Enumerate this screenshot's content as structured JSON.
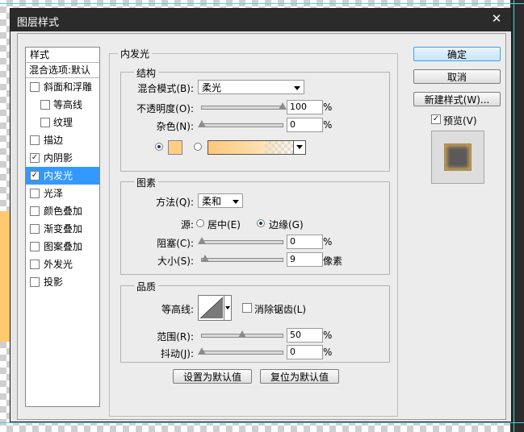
{
  "window": {
    "title": "图层样式",
    "close_glyph": "✕"
  },
  "style_list": {
    "header": "样式",
    "blend_options": "混合选项:默认",
    "items": [
      {
        "label": "斜面和浮雕",
        "checked": false,
        "indent": false
      },
      {
        "label": "等高线",
        "checked": false,
        "indent": true
      },
      {
        "label": "纹理",
        "checked": false,
        "indent": true
      },
      {
        "label": "描边",
        "checked": false,
        "indent": false
      },
      {
        "label": "内阴影",
        "checked": true,
        "indent": false
      },
      {
        "label": "内发光",
        "checked": true,
        "indent": false,
        "selected": true
      },
      {
        "label": "光泽",
        "checked": false,
        "indent": false
      },
      {
        "label": "颜色叠加",
        "checked": false,
        "indent": false
      },
      {
        "label": "渐变叠加",
        "checked": false,
        "indent": false
      },
      {
        "label": "图案叠加",
        "checked": false,
        "indent": false
      },
      {
        "label": "外发光",
        "checked": false,
        "indent": false
      },
      {
        "label": "投影",
        "checked": false,
        "indent": false
      }
    ]
  },
  "panel": {
    "title": "内发光",
    "structure": {
      "legend": "结构",
      "blend_mode_label": "混合模式(B):",
      "blend_mode_value": "柔光",
      "opacity_label": "不透明度(O):",
      "opacity_value": "100",
      "opacity_fraction": 1.0,
      "noise_label": "杂色(N):",
      "noise_value": "0",
      "noise_fraction": 0.0,
      "percent": "%",
      "glow_color": "#ffcd86"
    },
    "elements": {
      "legend": "图素",
      "technique_label": "方法(Q):",
      "technique_value": "柔和",
      "source_label": "源:",
      "source_center": "居中(E)",
      "source_edge": "边缘(G)",
      "choke_label": "阻塞(C):",
      "choke_value": "0",
      "choke_fraction": 0.0,
      "size_label": "大小(S):",
      "size_value": "9",
      "size_fraction": 0.036,
      "size_unit": "像素",
      "percent": "%"
    },
    "quality": {
      "legend": "品质",
      "contour_label": "等高线:",
      "antialias_label": "消除锯齿(L)",
      "range_label": "范围(R):",
      "range_value": "50",
      "range_fraction": 0.5,
      "jitter_label": "抖动(J):",
      "jitter_value": "0",
      "jitter_fraction": 0.0,
      "percent": "%"
    },
    "make_default": "设置为默认值",
    "reset_default": "复位为默认值"
  },
  "buttons": {
    "ok": "确定",
    "cancel": "取消",
    "new_style": "新建样式(W)...",
    "preview": "预览(V)",
    "preview_checked": true
  },
  "colors": {
    "accent": "#3399ff",
    "glow": "#ffcd86"
  }
}
